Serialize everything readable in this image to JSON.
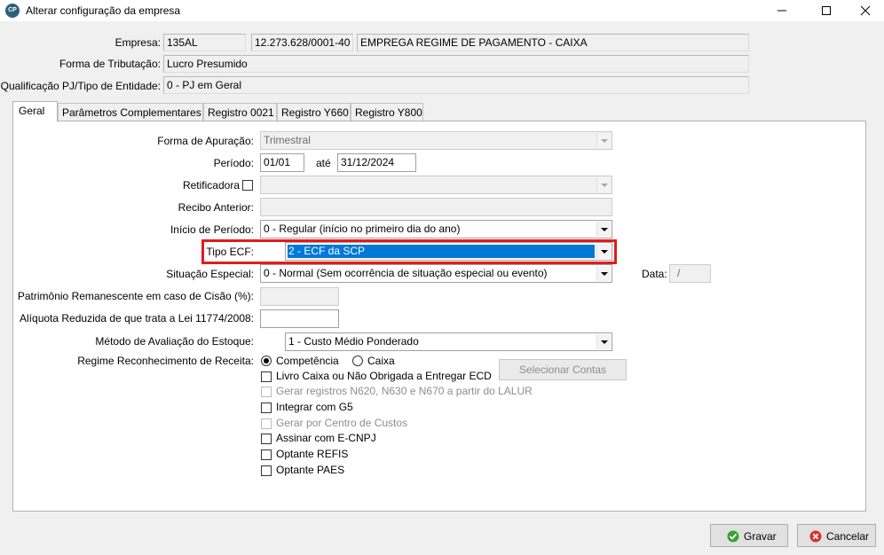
{
  "window": {
    "title": "Alterar configuração da empresa",
    "icon_text": "CP"
  },
  "header": {
    "empresa_label": "Empresa:",
    "empresa_code": "135AL",
    "empresa_cnpj": "12.273.628/0001-40",
    "empresa_name": "EMPREGA REGIME DE PAGAMENTO - CAIXA",
    "tributacao_label": "Forma de Tributação:",
    "tributacao_value": "Lucro Presumido",
    "qualificacao_label": "Qualificação PJ/Tipo de Entidade:",
    "qualificacao_value": "0 - PJ em Geral"
  },
  "tabs": [
    {
      "label": "Geral",
      "active": true
    },
    {
      "label": "Parâmetros Complementares"
    },
    {
      "label": "Registro 0021"
    },
    {
      "label": "Registro Y660"
    },
    {
      "label": "Registro Y800"
    }
  ],
  "form": {
    "apuracao_label": "Forma de Apuração:",
    "apuracao_value": "Trimestral",
    "periodo_label": "Período:",
    "periodo_inicio": "01/01",
    "ate_label": "até",
    "periodo_fim": "31/12/2024",
    "retificadora_label": "Retificadora",
    "recibo_label": "Recibo Anterior:",
    "inicio_label": "Início de Período:",
    "inicio_value": "0 - Regular (início no primeiro dia do ano)",
    "tipo_ecf_label": "Tipo ECF:",
    "tipo_ecf_value": "2 - ECF da SCP",
    "situacao_label": "Situação Especial:",
    "situacao_value": "0 - Normal (Sem ocorrência de situação especial ou evento)",
    "data_label": "Data:",
    "data_value": "/",
    "patrimonio_label": "Patrimônio Remanescente em caso de Cisão (%):",
    "aliquota_label": "Alíquota Reduzida de que trata a Lei 11774/2008:",
    "metodo_label": "Método de Avaliação do Estoque:",
    "metodo_value": "1 - Custo Médio Ponderado",
    "regime_label": "Regime Reconhecimento de Receita:",
    "regime_competencia": "Competência",
    "regime_caixa": "Caixa",
    "selecionar_contas": "Selecionar Contas",
    "options": [
      {
        "label": "Livro Caixa ou Não Obrigada a Entregar ECD",
        "enabled": true
      },
      {
        "label": "Gerar registros N620, N630 e N670 a partir do LALUR",
        "enabled": false
      },
      {
        "label": "Integrar com G5",
        "enabled": true
      },
      {
        "label": "Gerar por Centro de Custos",
        "enabled": false
      },
      {
        "label": "Assinar com E-CNPJ",
        "enabled": true
      },
      {
        "label": "Optante REFIS",
        "enabled": true
      },
      {
        "label": "Optante PAES",
        "enabled": true
      }
    ]
  },
  "footer": {
    "gravar": "Gravar",
    "cancelar": "Cancelar"
  },
  "colors": {
    "selection": "#0078d7",
    "highlight": "#e21c1c",
    "ok_icon": "#3aa335",
    "cancel_icon": "#d9302c"
  }
}
